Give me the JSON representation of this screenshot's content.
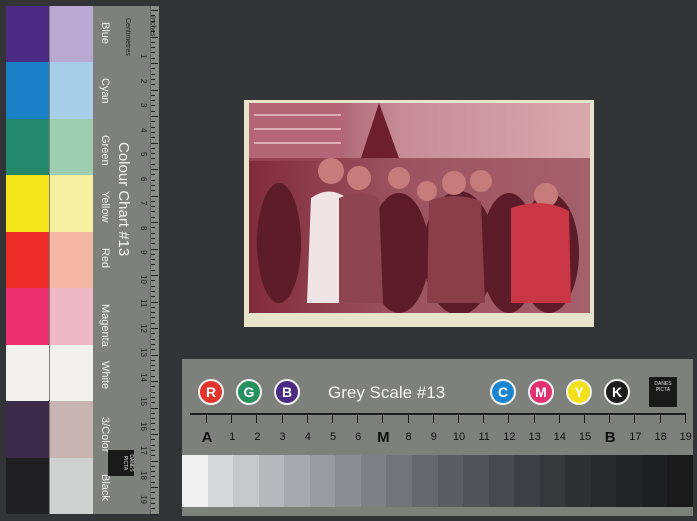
{
  "colour_chart": {
    "title": "Colour Chart #13",
    "ruler_units_inches": "Inches",
    "ruler_units_cm": "Centimetres",
    "logo_text": "DANES PICTA",
    "swatches": [
      {
        "label": "Blue",
        "dark": "#4a2a82",
        "light": "#b9a9d2"
      },
      {
        "label": "Cyan",
        "dark": "#1b7fc6",
        "light": "#a8cde9"
      },
      {
        "label": "Green",
        "dark": "#23896a",
        "light": "#9fcdb2"
      },
      {
        "label": "Yellow",
        "dark": "#f2e51a",
        "light": "#f6f0a2"
      },
      {
        "label": "Red",
        "dark": "#ec2a27",
        "light": "#f3b7a3"
      },
      {
        "label": "Magenta",
        "dark": "#ee2f6f",
        "light": "#efb8c9"
      },
      {
        "label": "White",
        "dark": "#f3f1ed",
        "light": "#f3f1ed"
      },
      {
        "label": "3/Color",
        "dark": "#3b2d4a",
        "light": "#c9b4b4"
      },
      {
        "label": "Black",
        "dark": "#201f22",
        "light": "#cfd0d0"
      }
    ],
    "ruler_numbers": [
      "1",
      "2",
      "3",
      "4",
      "5",
      "6",
      "7",
      "8",
      "9",
      "10",
      "11",
      "12",
      "13",
      "14",
      "15",
      "16",
      "17",
      "18",
      "19"
    ]
  },
  "grey_scale": {
    "title": "Grey Scale #13",
    "logo_text": "DANES PICTA",
    "rgb_dots": [
      {
        "letter": "R",
        "color": "#e0342d"
      },
      {
        "letter": "G",
        "color": "#26905e"
      },
      {
        "letter": "B",
        "color": "#4a2a82"
      }
    ],
    "cmyk_dots": [
      {
        "letter": "C",
        "color": "#1b86cf"
      },
      {
        "letter": "M",
        "color": "#e33070"
      },
      {
        "letter": "Y",
        "color": "#f1e01a"
      },
      {
        "letter": "K",
        "color": "#1d1d1d"
      }
    ],
    "scale_labels": [
      "A",
      "1",
      "2",
      "3",
      "4",
      "5",
      "6",
      "M",
      "8",
      "9",
      "10",
      "11",
      "12",
      "13",
      "14",
      "15",
      "B",
      "17",
      "18",
      "19"
    ],
    "steps": [
      "#f1f1f1",
      "#d8d9da",
      "#c6c8ca",
      "#b6b8ba",
      "#a7a9ac",
      "#999b9e",
      "#8b8d90",
      "#7e8083",
      "#727477",
      "#66686b",
      "#5b5d60",
      "#515356",
      "#47494c",
      "#3e4043",
      "#36383a",
      "#2f3032",
      "#28292b",
      "#232425",
      "#1e1f20",
      "#1a1a1b"
    ]
  },
  "photograph": {
    "tint": "#7a2b3a"
  }
}
